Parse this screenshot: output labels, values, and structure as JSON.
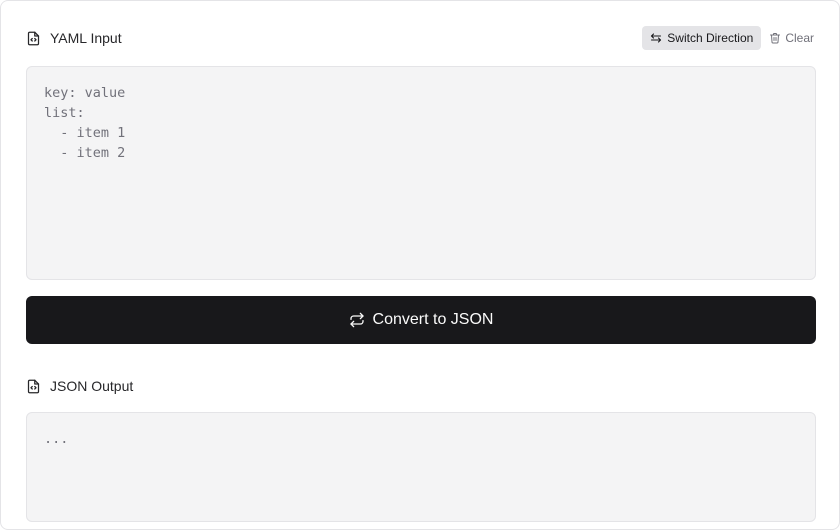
{
  "input_section": {
    "title": "YAML Input",
    "icon": "file-code-icon",
    "switch_label": "Switch Direction",
    "clear_label": "Clear",
    "placeholder": "key: value\nlist:\n  - item 1\n  - item 2"
  },
  "convert_button": {
    "label": "Convert to JSON",
    "icon": "repeat-icon"
  },
  "output_section": {
    "title": "JSON Output",
    "icon": "file-code-icon",
    "content": "..."
  },
  "colors": {
    "primary": "#18181b",
    "editor_bg": "#f4f4f5",
    "border": "#e4e4e7",
    "muted_text": "#71717a"
  }
}
